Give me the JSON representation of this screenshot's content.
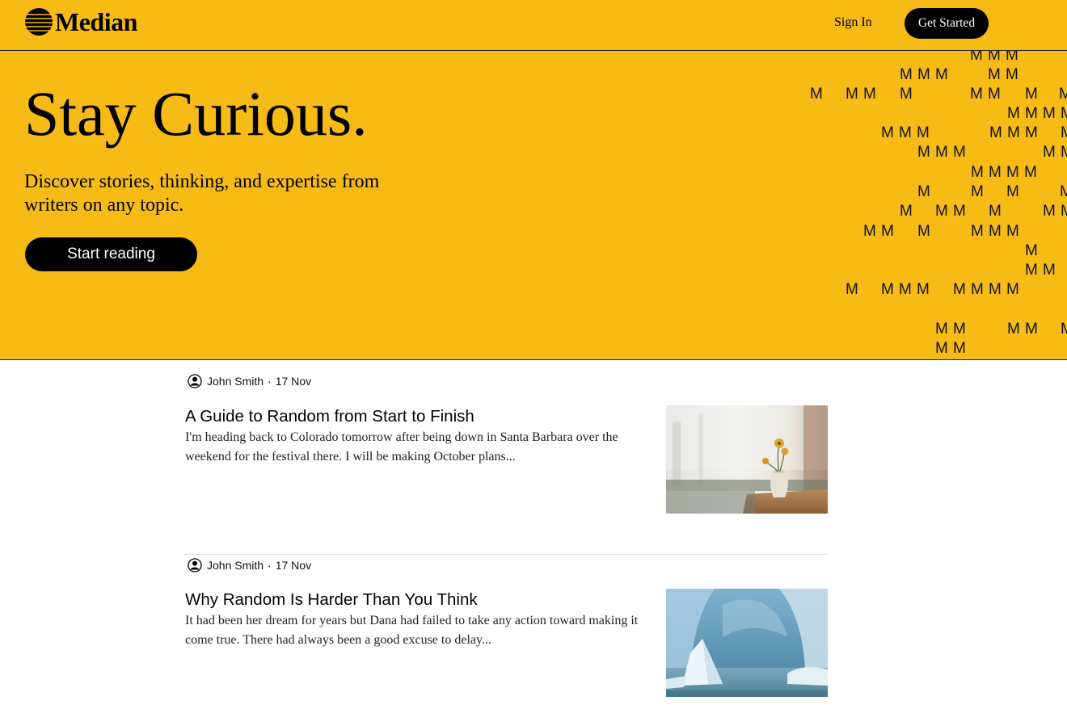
{
  "header": {
    "brand": "Median",
    "sign_in": "Sign In",
    "get_started": "Get Started"
  },
  "hero": {
    "title": "Stay Curious.",
    "subtitle": "Discover stories, thinking, and expertise from writers on any topic.",
    "cta": "Start reading",
    "pattern_glyph": "M"
  },
  "articles": [
    {
      "author": "John Smith",
      "date": "17 Nov",
      "title": "A Guide to Random from Start to Finish",
      "excerpt": "I'm heading back to Colorado tomorrow after being down in Santa Barbara over the weekend for the festival there. I will be making October plans...",
      "image": "flower-vase-photo"
    },
    {
      "author": "John Smith",
      "date": "17 Nov",
      "title": "Why Random Is Harder Than You Think",
      "excerpt": "It had been her dream for years but Dana had failed to take any action toward making it come true. There had always been a good excuse to delay...",
      "image": "ice-cave-photo"
    }
  ],
  "colors": {
    "brand_yellow": "#f7bb16",
    "button_black": "#000000"
  }
}
